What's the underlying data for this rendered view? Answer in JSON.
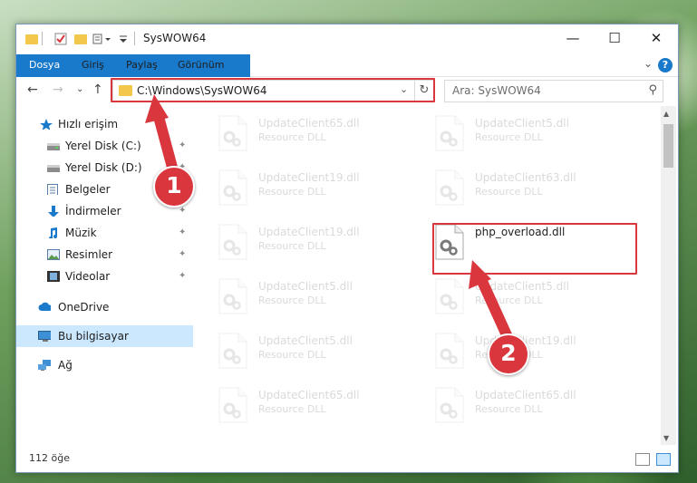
{
  "window": {
    "title": "SysWOW64"
  },
  "ribbon": {
    "tabs": [
      "Dosya",
      "Giriş",
      "Paylaş",
      "Görünüm"
    ],
    "help": "?"
  },
  "address": {
    "path": "C:\\Windows\\SysWOW64"
  },
  "search": {
    "placeholder": "Ara: SysWOW64"
  },
  "sidebar": {
    "items": [
      {
        "label": "Hızlı erişim",
        "icon": "star-icon"
      },
      {
        "label": "Yerel Disk (C:)",
        "icon": "drive-icon"
      },
      {
        "label": "Yerel Disk (D:)",
        "icon": "drive-icon"
      },
      {
        "label": "Belgeler",
        "icon": "document-icon"
      },
      {
        "label": "İndirmeler",
        "icon": "download-icon"
      },
      {
        "label": "Müzik",
        "icon": "music-icon"
      },
      {
        "label": "Resimler",
        "icon": "pictures-icon"
      },
      {
        "label": "Videolar",
        "icon": "video-icon"
      },
      {
        "label": "OneDrive",
        "icon": "cloud-icon"
      },
      {
        "label": "Bu bilgisayar",
        "icon": "computer-icon"
      },
      {
        "label": "Ağ",
        "icon": "network-icon"
      }
    ]
  },
  "files": {
    "left": [
      {
        "name": "UpdateClient65.dll",
        "type": "Resource DLL"
      },
      {
        "name": "UpdateClient19.dll",
        "type": "Resource DLL"
      },
      {
        "name": "UpdateClient19.dll",
        "type": "Resource DLL"
      },
      {
        "name": "UpdateClient5.dll",
        "type": "Resource DLL"
      },
      {
        "name": "UpdateClient5.dll",
        "type": "Resource DLL"
      },
      {
        "name": "UpdateClient65.dll",
        "type": "Resource DLL"
      }
    ],
    "right": [
      {
        "name": "UpdateClient5.dll",
        "type": "Resource DLL"
      },
      {
        "name": "UpdateClient63.dll",
        "type": "Resource DLL"
      },
      {
        "name": "php_overload.dll",
        "type": ""
      },
      {
        "name": "UpdateClient5.dll",
        "type": "Resource DLL"
      },
      {
        "name": "UpdateClient19.dll",
        "type": "Resource DLL"
      },
      {
        "name": "UpdateClient65.dll",
        "type": "Resource DLL"
      }
    ]
  },
  "status": {
    "count": "112 öğe"
  },
  "annotations": {
    "step1": "1",
    "step2": "2"
  },
  "colors": {
    "accent": "#1979ca",
    "highlight": "#d9363e",
    "selection": "#cce8ff"
  }
}
